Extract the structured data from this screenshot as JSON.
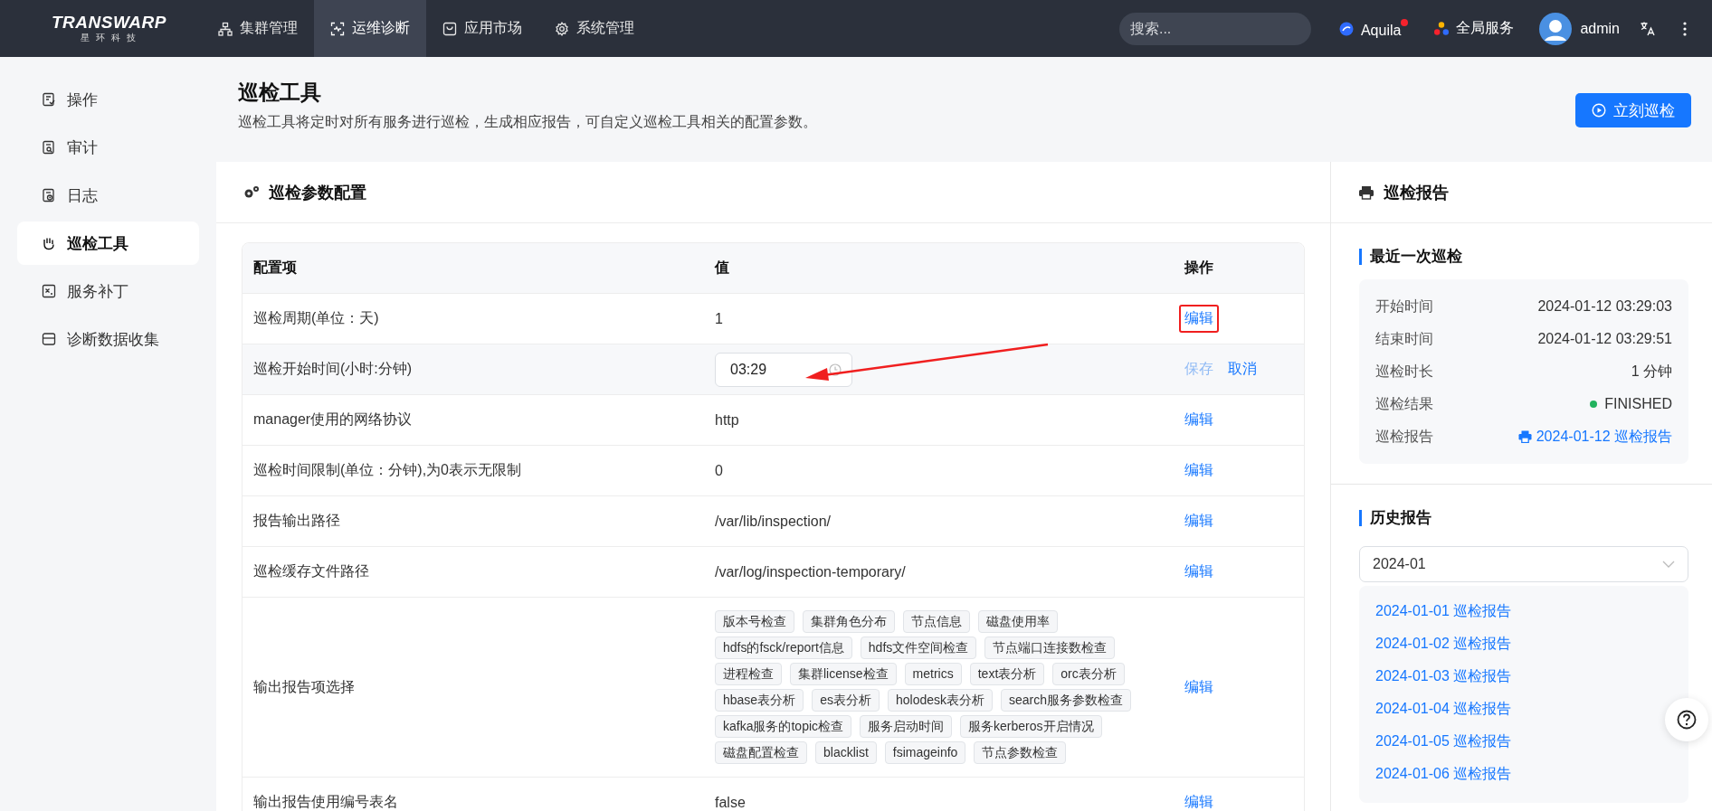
{
  "header": {
    "logo": {
      "brand": "TRANSWARP",
      "subtitle": "星 环 科 技"
    },
    "nav": [
      {
        "label": "集群管理",
        "selected": false
      },
      {
        "label": "运维诊断",
        "selected": true
      },
      {
        "label": "应用市场",
        "selected": false
      },
      {
        "label": "系统管理",
        "selected": false
      }
    ],
    "search": {
      "placeholder": "搜索..."
    },
    "links": [
      {
        "label": "Aquila",
        "badge": true
      },
      {
        "label": "全局服务",
        "badge": false
      }
    ],
    "user": "admin"
  },
  "sidebar": {
    "items": [
      {
        "label": "操作",
        "selected": false
      },
      {
        "label": "审计",
        "selected": false
      },
      {
        "label": "日志",
        "selected": false
      },
      {
        "label": "巡检工具",
        "selected": true
      },
      {
        "label": "服务补丁",
        "selected": false
      },
      {
        "label": "诊断数据收集",
        "selected": false
      }
    ]
  },
  "page": {
    "title": "巡检工具",
    "description": "巡检工具将定时对所有服务进行巡检，生成相应报告，可自定义巡检工具相关的配置参数。",
    "primary_button": "立刻巡检"
  },
  "config": {
    "title": "巡检参数配置",
    "columns": [
      "配置项",
      "值",
      "操作"
    ],
    "rows": [
      {
        "name": "巡检周期(单位：天)",
        "kind": "text",
        "value": "1",
        "actions": [
          {
            "label": "编辑",
            "disabled": false,
            "highlighted": true
          }
        ]
      },
      {
        "name": "巡检开始时间(小时:分钟)",
        "kind": "time-input",
        "value": "03:29",
        "pointed": true,
        "actions": [
          {
            "label": "保存",
            "disabled": true,
            "highlighted": false
          },
          {
            "label": "取消",
            "disabled": false,
            "highlighted": false
          }
        ]
      },
      {
        "name": "manager使用的网络协议",
        "kind": "text",
        "value": "http",
        "actions": [
          {
            "label": "编辑",
            "disabled": false,
            "highlighted": false
          }
        ]
      },
      {
        "name": "巡检时间限制(单位：分钟),为0表示无限制",
        "kind": "text",
        "value": "0",
        "actions": [
          {
            "label": "编辑",
            "disabled": false,
            "highlighted": false
          }
        ]
      },
      {
        "name": "报告输出路径",
        "kind": "text",
        "value": "/var/lib/inspection/",
        "actions": [
          {
            "label": "编辑",
            "disabled": false,
            "highlighted": false
          }
        ]
      },
      {
        "name": "巡检缓存文件路径",
        "kind": "text",
        "value": "/var/log/inspection-temporary/",
        "actions": [
          {
            "label": "编辑",
            "disabled": false,
            "highlighted": false
          }
        ]
      },
      {
        "name": "输出报告项选择",
        "kind": "tags",
        "tag_lines": [
          [
            "版本号检查",
            "集群角色分布",
            "节点信息",
            "磁盘使用率"
          ],
          [
            "hdfs的fsck/report信息",
            "hdfs文件空间检查",
            "节点端口连接数检查"
          ],
          [
            "进程检查",
            "集群license检查",
            "metrics",
            "text表分析",
            "orc表分析"
          ],
          [
            "hbase表分析",
            "es表分析",
            "holodesk表分析",
            "search服务参数检查"
          ],
          [
            "kafka服务的topic检查",
            "服务启动时间",
            "服务kerberos开启情况"
          ],
          [
            "磁盘配置检查",
            "blacklist",
            "fsimageinfo",
            "节点参数检查"
          ]
        ],
        "actions": [
          {
            "label": "编辑",
            "disabled": false,
            "highlighted": false
          }
        ]
      },
      {
        "name": "输出报告使用编号表名",
        "kind": "text",
        "value": "false",
        "actions": [
          {
            "label": "编辑",
            "disabled": false,
            "highlighted": false
          }
        ]
      }
    ]
  },
  "report": {
    "title": "巡检报告",
    "latest": {
      "title": "最近一次巡检",
      "rows": [
        {
          "label": "开始时间",
          "kind": "text",
          "value": "2024-01-12 03:29:03"
        },
        {
          "label": "结束时间",
          "kind": "text",
          "value": "2024-01-12 03:29:51"
        },
        {
          "label": "巡检时长",
          "kind": "text",
          "value": "1 分钟"
        },
        {
          "label": "巡检结果",
          "kind": "status",
          "value": "FINISHED",
          "color": "#22b35e"
        },
        {
          "label": "巡检报告",
          "kind": "link",
          "value": "2024-01-12 巡检报告"
        }
      ]
    },
    "history": {
      "title": "历史报告",
      "month": "2024-01",
      "items": [
        "2024-01-01 巡检报告",
        "2024-01-02 巡检报告",
        "2024-01-03 巡检报告",
        "2024-01-04 巡检报告",
        "2024-01-05 巡检报告",
        "2024-01-06 巡检报告"
      ]
    }
  }
}
